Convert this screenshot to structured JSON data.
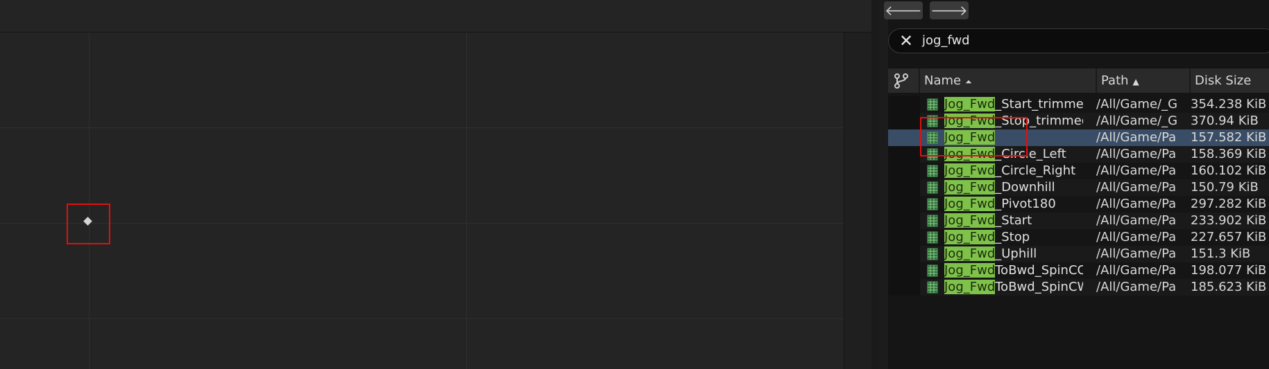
{
  "search": {
    "query": "jog_fwd"
  },
  "nav": {
    "back_icon": "🡐",
    "forward_icon": "🡒"
  },
  "columns": {
    "name": "Name",
    "path": "Path",
    "disk_size": "Disk Size"
  },
  "highlight_term": "Jog_Fwd",
  "rows": [
    {
      "name_rest": "_Start_trimmed",
      "path": "/All/Game/_G",
      "size": "354.238 KiB"
    },
    {
      "name_rest": "_Stop_trimmed",
      "path": "/All/Game/_G",
      "size": "370.94 KiB"
    },
    {
      "name_rest": "",
      "path": "/All/Game/Pa",
      "size": "157.582 KiB",
      "selected": true
    },
    {
      "name_rest": "_Circle_Left",
      "path": "/All/Game/Pa",
      "size": "158.369 KiB"
    },
    {
      "name_rest": "_Circle_Right",
      "path": "/All/Game/Pa",
      "size": "160.102 KiB"
    },
    {
      "name_rest": "_Downhill",
      "path": "/All/Game/Pa",
      "size": "150.79 KiB"
    },
    {
      "name_rest": "_Pivot180",
      "path": "/All/Game/Pa",
      "size": "297.282 KiB"
    },
    {
      "name_rest": "_Start",
      "path": "/All/Game/Pa",
      "size": "233.902 KiB"
    },
    {
      "name_rest": "_Stop",
      "path": "/All/Game/Pa",
      "size": "227.657 KiB"
    },
    {
      "name_rest": "_Uphill",
      "path": "/All/Game/Pa",
      "size": "151.3 KiB"
    },
    {
      "name_rest": "ToBwd_SpinCC",
      "path": "/All/Game/Pa",
      "size": "198.077 KiB"
    },
    {
      "name_rest": "ToBwd_SpinCW",
      "path": "/All/Game/Pa",
      "size": "185.623 KiB"
    }
  ],
  "colors": {
    "highlight_green": "#7fc24a",
    "selection_blue": "#3a4d66",
    "annotation_red": "#e01010"
  }
}
